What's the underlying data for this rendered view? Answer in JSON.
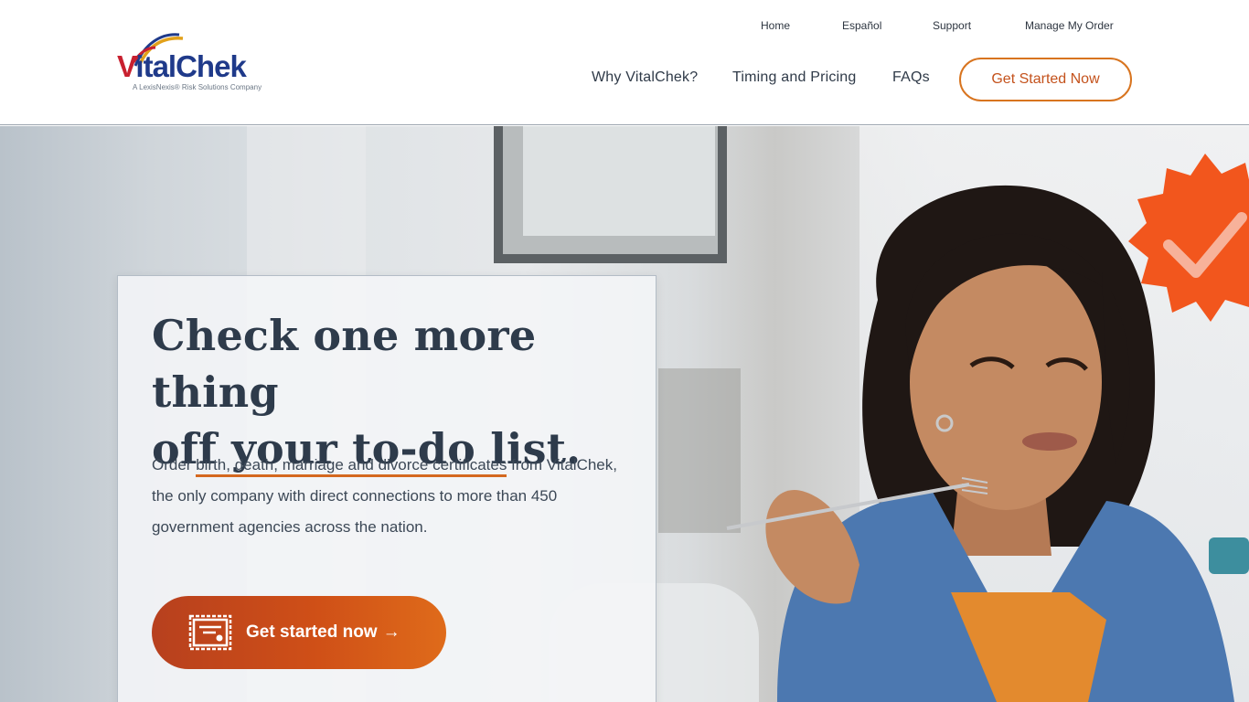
{
  "brand": {
    "name": "VitalChek",
    "name_first": "V",
    "name_rest": "italChek",
    "tagline": "A LexisNexis® Risk Solutions Company"
  },
  "util_nav": {
    "items": [
      {
        "label": "Home"
      },
      {
        "label": "Español"
      },
      {
        "label": "Support"
      },
      {
        "label": "Manage My Order"
      }
    ]
  },
  "main_nav": {
    "items": [
      {
        "label": "Why VitalChek?"
      },
      {
        "label": "Timing and Pricing"
      },
      {
        "label": "FAQs"
      }
    ],
    "cta_label": "Get Started Now"
  },
  "hero": {
    "headline_line1": "Check one more thing",
    "headline_line2": "off your to-do list.",
    "lead_prefix": "Order ",
    "lead_link": "birth, death, marriage and divorce certificates",
    "lead_suffix": " from VitalChek, the only company with direct connections to more than 450 government agencies across the nation.",
    "cta_label": "Get started now",
    "cta_arrow": "→"
  },
  "colors": {
    "accent_orange": "#d8741f",
    "cta_gradient_start": "#b7401e",
    "cta_gradient_end": "#df6b1a",
    "heading": "#2e3b4b",
    "brand_blue": "#1f3a8a",
    "brand_red": "#c8202f"
  },
  "icons": {
    "cta": "certificate-icon",
    "badge": "checkmark-badge-icon"
  }
}
